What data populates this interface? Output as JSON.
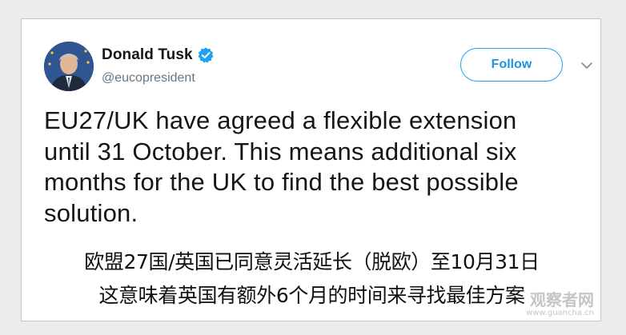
{
  "tweet": {
    "display_name": "Donald Tusk",
    "handle": "@eucopresident",
    "follow_label": "Follow",
    "text": "EU27/UK have agreed a flexible extension\nuntil 31 October. This means additional six\nmonths for the UK to find the best possible\nsolution."
  },
  "caption": {
    "line1": "欧盟27国/英国已同意灵活延长（脱欧）至10月31日",
    "line2": "这意味着英国有额外6个月的时间来寻找最佳方案"
  },
  "watermark": {
    "main": "观察者网",
    "sub": "www.guancha.cn"
  },
  "colors": {
    "accent": "#1da1f2",
    "verified": "#1da1f2",
    "handle": "#657786",
    "text": "#14171a"
  },
  "icons": {
    "verified": "verified-badge-icon",
    "menu": "chevron-down-icon"
  }
}
